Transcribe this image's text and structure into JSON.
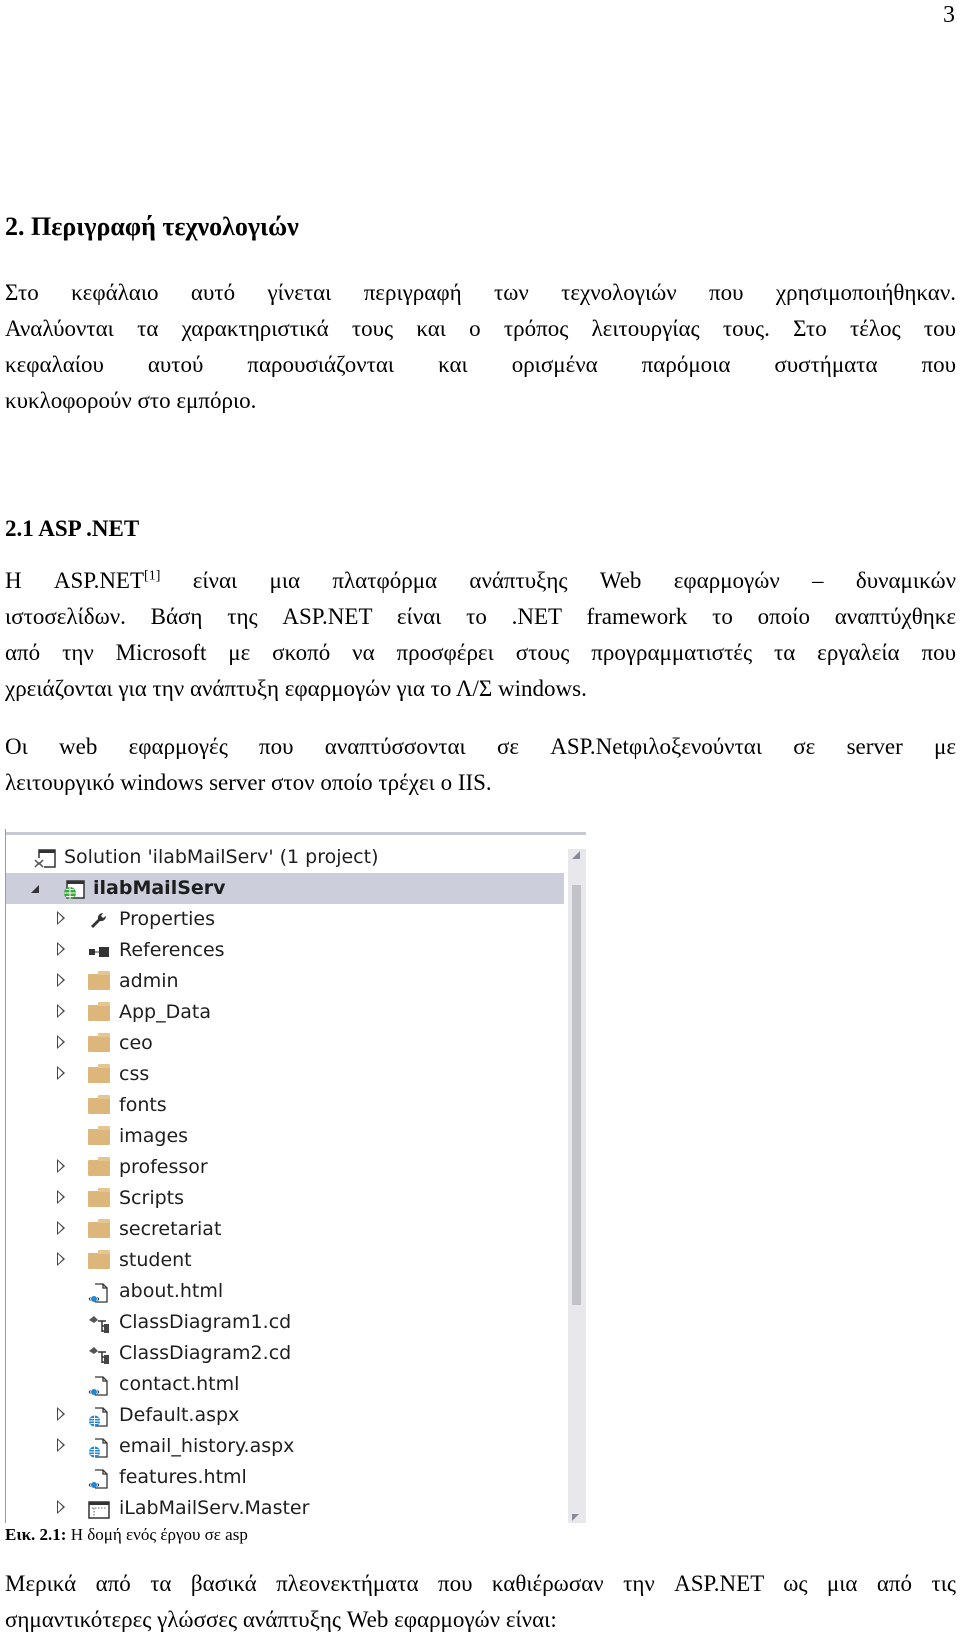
{
  "page_number": "3",
  "heading1": "2. Περιγραφή τεχνολογιών",
  "intro_lines": [
    "Στο κεφάλαιο αυτό γίνεται περιγραφή των τεχνολογιών που χρησιμοποιήθηκαν.",
    "Αναλύονται τα χαρακτηριστικά τους και ο τρόπος λειτουργίας τους. Στο τέλος του",
    "κεφαλαίου αυτού παρουσιάζονται και ορισμένα παρόμοια συστήματα που",
    "κυκλοφορούν στο εμπόριο."
  ],
  "heading2": "2.1 ASP .NET",
  "asp_para": {
    "line1_prefix": "Η ASP.NET",
    "line1_sup": "[1]",
    "line1_suffix": " είναι μια πλατφόρμα ανάπτυξης Web εφαρμογών – δυναμικών",
    "lines": [
      "ιστοσελίδων. Βάση της ASP.NET είναι το .NET framework το οποίο αναπτύχθηκε",
      "από την Microsoft με σκοπό να προσφέρει στους προγραμματιστές τα εργαλεία που",
      "χρειάζονται για την ανάπτυξη εφαρμογών για το Λ/Σ windows."
    ]
  },
  "hosting_lines": [
    "Οι web εφαρμογές που αναπτύσσονται σε ASP.Netφιλοξενούνται σε server με",
    "λειτουργικό windows server στον οποίο τρέχει ο IIS."
  ],
  "solution_explorer": {
    "solution_label": "Solution 'ilabMailServ' (1 project)",
    "project_label": "ilabMailServ",
    "items": [
      {
        "label": "Properties",
        "icon": "wrench-icon",
        "expandable": true
      },
      {
        "label": "References",
        "icon": "references-icon",
        "expandable": true
      },
      {
        "label": "admin",
        "icon": "folder-icon",
        "expandable": true
      },
      {
        "label": "App_Data",
        "icon": "folder-icon",
        "expandable": true
      },
      {
        "label": "ceo",
        "icon": "folder-icon",
        "expandable": true
      },
      {
        "label": "css",
        "icon": "folder-icon",
        "expandable": true
      },
      {
        "label": "fonts",
        "icon": "folder-icon",
        "expandable": false
      },
      {
        "label": "images",
        "icon": "folder-icon",
        "expandable": false
      },
      {
        "label": "professor",
        "icon": "folder-icon",
        "expandable": true
      },
      {
        "label": "Scripts",
        "icon": "folder-icon",
        "expandable": true
      },
      {
        "label": "secretariat",
        "icon": "folder-icon",
        "expandable": true
      },
      {
        "label": "student",
        "icon": "folder-icon",
        "expandable": true
      },
      {
        "label": "about.html",
        "icon": "html-file-icon",
        "expandable": false
      },
      {
        "label": "ClassDiagram1.cd",
        "icon": "class-diagram-icon",
        "expandable": false
      },
      {
        "label": "ClassDiagram2.cd",
        "icon": "class-diagram-icon",
        "expandable": false
      },
      {
        "label": "contact.html",
        "icon": "html-file-icon",
        "expandable": false
      },
      {
        "label": "Default.aspx",
        "icon": "aspx-file-icon",
        "expandable": true
      },
      {
        "label": "email_history.aspx",
        "icon": "aspx-file-icon",
        "expandable": true
      },
      {
        "label": "features.html",
        "icon": "html-file-icon",
        "expandable": false
      },
      {
        "label": "iLabMailServ.Master",
        "icon": "master-page-icon",
        "expandable": true
      }
    ],
    "colors": {
      "selected_row": "#cccedb",
      "folder": "#dcb67a",
      "globe": "#3ca83c",
      "aspx_globe": "#1e88d8"
    }
  },
  "caption": {
    "label": "Εικ. 2.1:",
    "text": " Η δομή ενός έργου σε asp"
  },
  "closing_lines": [
    "Μερικά από τα βασικά πλεονεκτήματα που καθιέρωσαν την ASP.NET ως μια από τις",
    "σημαντικότερες γλώσσες ανάπτυξης Web εφαρμογών είναι:"
  ]
}
